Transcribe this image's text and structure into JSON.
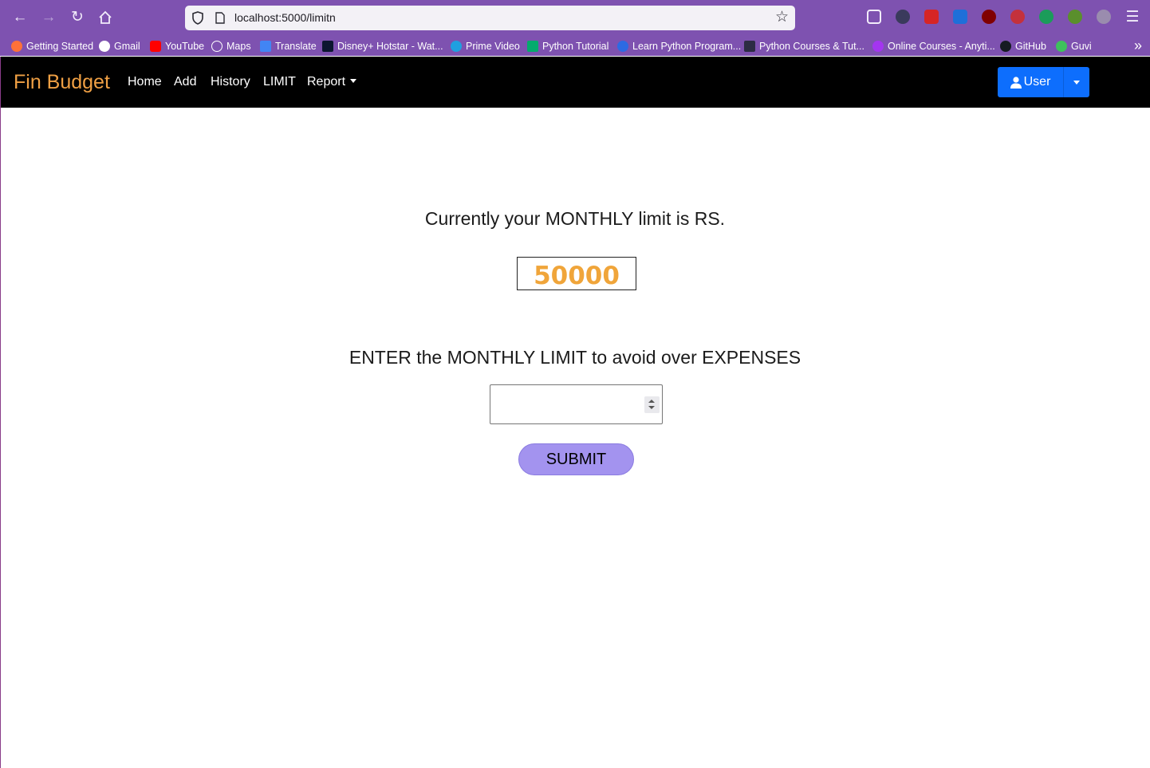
{
  "browser": {
    "url": "localhost:5000/limitn",
    "bookmarks": [
      {
        "label": "Getting Started",
        "icon": "firefox-icon",
        "color": "#ff7139"
      },
      {
        "label": "Gmail",
        "icon": "google-icon",
        "color": "#ffffff"
      },
      {
        "label": "YouTube",
        "icon": "youtube-icon",
        "color": "#ff0000"
      },
      {
        "label": "Maps",
        "icon": "globe-icon",
        "color": "#d9d0e6"
      },
      {
        "label": "Translate",
        "icon": "translate-icon",
        "color": "#4285f4"
      },
      {
        "label": "Disney+ Hotstar - Wat...",
        "icon": "hotstar-icon",
        "color": "#0b1630"
      },
      {
        "label": "Prime Video",
        "icon": "prime-video-icon",
        "color": "#1fa0e0"
      },
      {
        "label": "Python Tutorial",
        "icon": "w3schools-icon",
        "color": "#04aa6d"
      },
      {
        "label": "Learn Python Program...",
        "icon": "programiz-icon",
        "color": "#2d6ae3"
      },
      {
        "label": "Python Courses & Tut...",
        "icon": "document-icon",
        "color": "#2c2c44"
      },
      {
        "label": "Online Courses - Anyti...",
        "icon": "udemy-icon",
        "color": "#a435f0"
      },
      {
        "label": "GitHub",
        "icon": "github-icon",
        "color": "#161b22"
      },
      {
        "label": "Guvi",
        "icon": "guvi-icon",
        "color": "#3ec15c"
      }
    ]
  },
  "navbar": {
    "brand": "Fin Budget",
    "links": [
      "Home",
      "Add",
      "History",
      "LIMIT",
      "Report"
    ],
    "user_label": "User"
  },
  "main": {
    "current_heading": "Currently your MONTHLY limit is RS.",
    "current_limit": "50000",
    "enter_heading": "ENTER the MONTHLY LIMIT to avoid over EXPENSES",
    "limit_input_value": "",
    "submit_label": "SUBMIT"
  },
  "colors": {
    "browser_chrome": "#7e52b0",
    "brand": "#f0a044",
    "limit_value": "#f0a53a",
    "user_button": "#0d6efd",
    "submit_button": "#a393ef"
  }
}
